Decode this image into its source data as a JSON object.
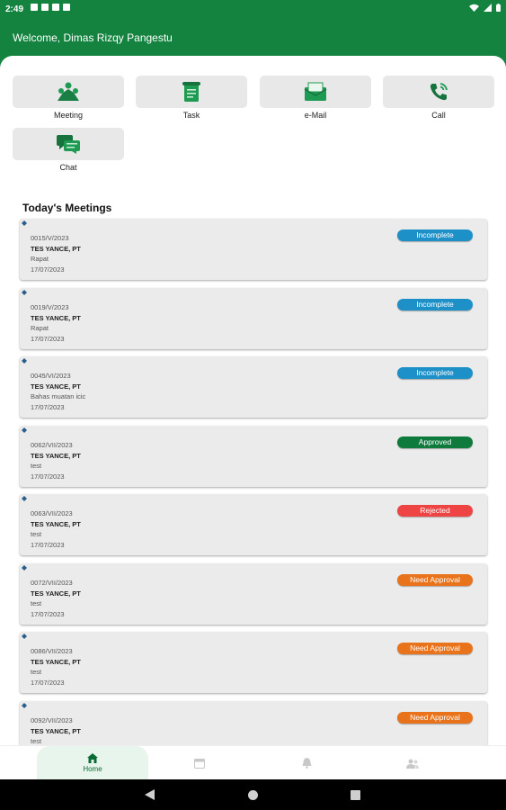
{
  "status_bar": {
    "time": "2:49"
  },
  "header": {
    "welcome": "Welcome, Dimas Rizqy Pangestu"
  },
  "quick_actions": [
    {
      "label": "Meeting",
      "icon": "meeting-icon"
    },
    {
      "label": "Task",
      "icon": "task-icon"
    },
    {
      "label": "e-Mail",
      "icon": "email-icon"
    },
    {
      "label": "Call",
      "icon": "phone-icon"
    },
    {
      "label": "Chat",
      "icon": "chat-icon"
    }
  ],
  "meetings_section": {
    "title": "Today's Meetings"
  },
  "meetings": [
    {
      "code": "0015/V/2023",
      "company": "TES YANCE, PT",
      "desc": "Rapat",
      "date": "17/07/2023",
      "status": "Incomplete",
      "status_color": "#1e90c8"
    },
    {
      "code": "0019/V/2023",
      "company": "TES YANCE, PT",
      "desc": "Rapat",
      "date": "17/07/2023",
      "status": "Incomplete",
      "status_color": "#1e90c8"
    },
    {
      "code": "0045/VI/2023",
      "company": "TES YANCE, PT",
      "desc": "Bahas muatan icic",
      "date": "17/07/2023",
      "status": "Incomplete",
      "status_color": "#1e90c8"
    },
    {
      "code": "0062/VII/2023",
      "company": "TES YANCE, PT",
      "desc": "test",
      "date": "17/07/2023",
      "status": "Approved",
      "status_color": "#0e7a3c"
    },
    {
      "code": "0063/VII/2023",
      "company": "TES YANCE, PT",
      "desc": "test",
      "date": "17/07/2023",
      "status": "Rejected",
      "status_color": "#ef4444"
    },
    {
      "code": "0072/VII/2023",
      "company": "TES YANCE, PT",
      "desc": "test",
      "date": "17/07/2023",
      "status": "Need Approval",
      "status_color": "#e8731a"
    },
    {
      "code": "0086/VII/2023",
      "company": "TES YANCE, PT",
      "desc": "test",
      "date": "17/07/2023",
      "status": "Need Approval",
      "status_color": "#e8731a"
    },
    {
      "code": "0092/VII/2023",
      "company": "TES YANCE, PT",
      "desc": "test",
      "date": "",
      "status": "Need Approval",
      "status_color": "#e8731a"
    }
  ],
  "bottom_nav": {
    "home_label": "Home",
    "items": [
      "home-icon",
      "calendar-icon",
      "bell-icon",
      "people-icon"
    ]
  },
  "colors": {
    "brand": "#13833f",
    "incomplete": "#1e90c8",
    "approved": "#0e7a3c",
    "rejected": "#ef4444",
    "need_approval": "#e8731a"
  }
}
